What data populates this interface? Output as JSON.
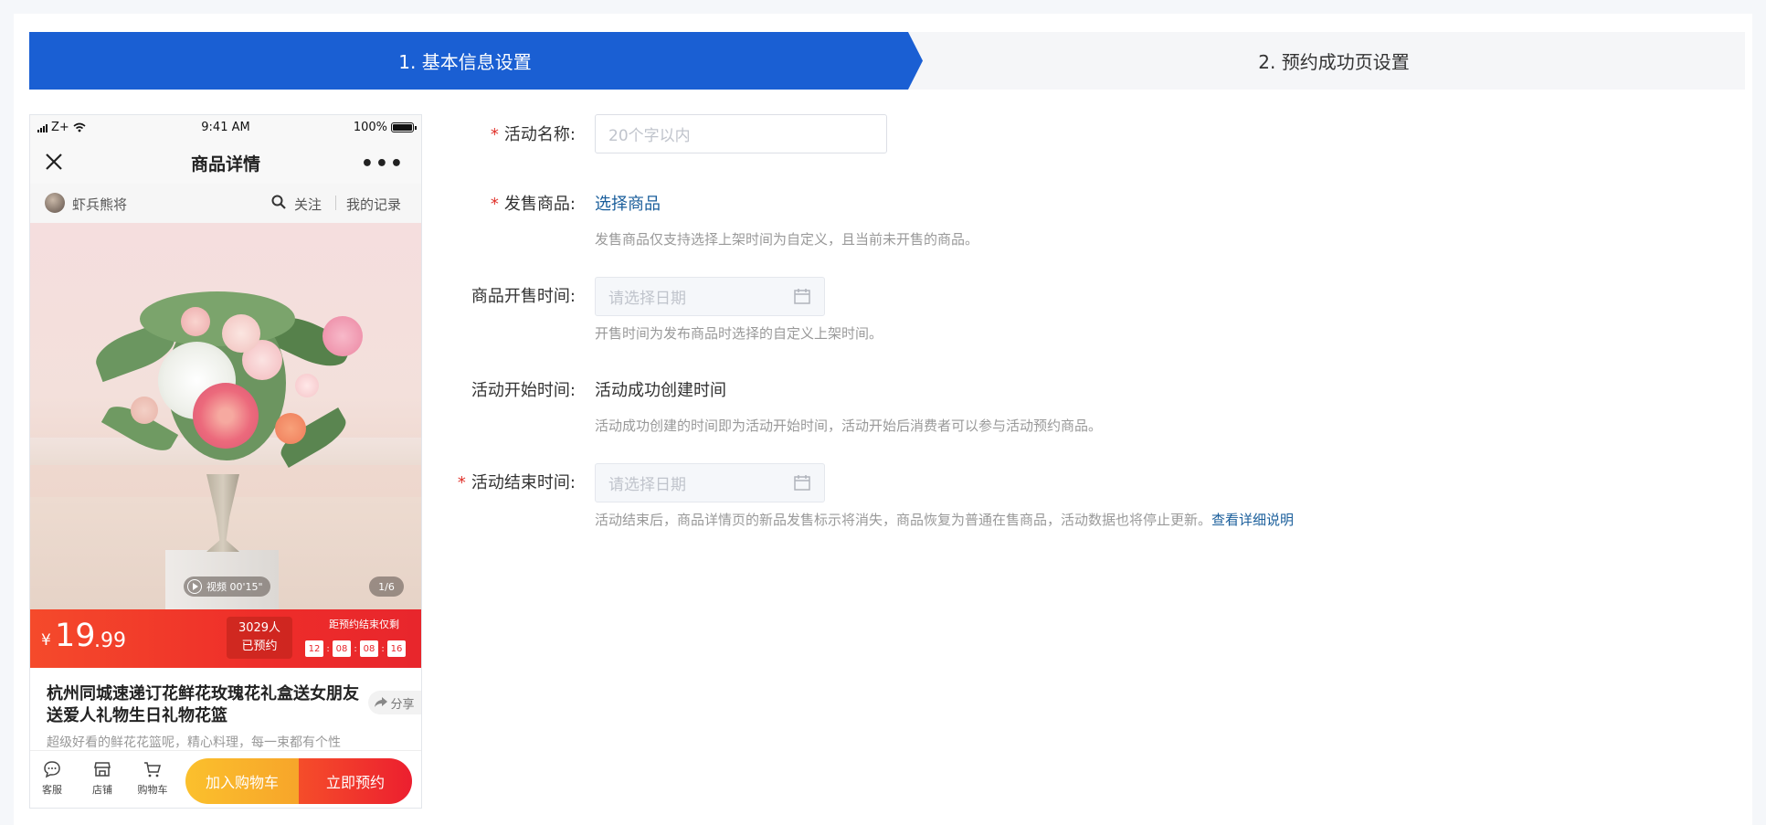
{
  "steps": {
    "step1": "1. 基本信息设置",
    "step2": "2. 预约成功页设置"
  },
  "phone": {
    "status": {
      "carrier": "Z+",
      "time": "9:41 AM",
      "battery": "100%"
    },
    "nav_title": "商品详情",
    "nav_more": "•••",
    "shop": {
      "name": "虾兵熊将",
      "follow": "关注",
      "record": "我的记录"
    },
    "video_chip": "视频 00'15\"",
    "pager": "1/6",
    "price": {
      "symbol": "¥",
      "integer": "19",
      "decimal": ".99"
    },
    "booked": {
      "count": "3029人",
      "label": "已预约"
    },
    "countdown": {
      "label": "距预约结束仅剩",
      "cells": [
        "12",
        "08",
        "08",
        "16"
      ]
    },
    "product_title": "杭州同城速递订花鲜花玫瑰花礼盒送女朋友送爱人礼物生日礼物花篮",
    "share": "分享",
    "product_desc": "超级好看的鲜花花篮呢，精心料理，每一束都有个性",
    "actions": {
      "service": "客服",
      "shop": "店铺",
      "cart": "购物车"
    },
    "btn_cart": "加入购物车",
    "btn_book": "立即预约"
  },
  "form": {
    "activity_name": {
      "label": "活动名称:",
      "placeholder": "20个字以内"
    },
    "sale_product": {
      "label": "发售商品:",
      "link": "选择商品",
      "help": "发售商品仅支持选择上架时间为自定义，且当前未开售的商品。"
    },
    "sale_time": {
      "label": "商品开售时间:",
      "placeholder": "请选择日期",
      "help": "开售时间为发布商品时选择的自定义上架时间。"
    },
    "start_time": {
      "label": "活动开始时间:",
      "value": "活动成功创建时间",
      "help": "活动成功创建的时间即为活动开始时间，活动开始后消费者可以参与活动预约商品。"
    },
    "end_time": {
      "label": "活动结束时间:",
      "placeholder": "请选择日期",
      "help": "活动结束后，商品详情页的新品发售标示将消失，商品恢复为普通在售商品，活动数据也将停止更新。",
      "help_link": "查看详细说明"
    },
    "required_mark": "*"
  },
  "colors": {
    "primary": "#1a5fd3",
    "link": "#1a5e9b",
    "required": "#e0322b",
    "price_red": "#ee2d2a"
  }
}
